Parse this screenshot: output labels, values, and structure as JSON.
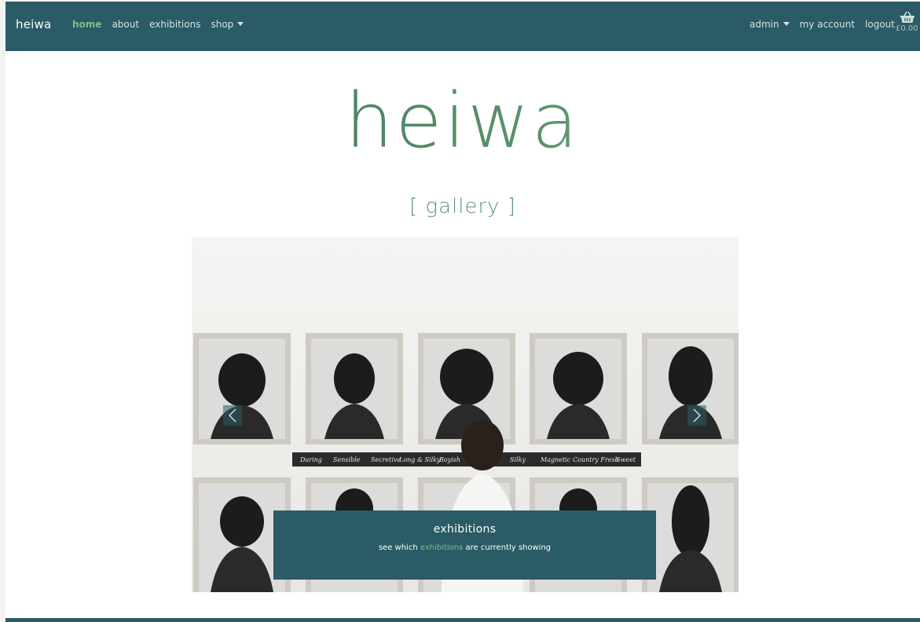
{
  "nav": {
    "brand": "heiwa",
    "items": [
      {
        "label": "home",
        "active": true
      },
      {
        "label": "about",
        "active": false
      },
      {
        "label": "exhibitions",
        "active": false
      },
      {
        "label": "shop",
        "active": false
      }
    ],
    "right_items": [
      {
        "label": "admin"
      },
      {
        "label": "my account"
      },
      {
        "label": "logout"
      }
    ],
    "basket_total": "£0.00",
    "basket_icon": "basket-icon"
  },
  "hero": {
    "logo": "heiwa",
    "tagline": "[ gallery ]"
  },
  "carousel": {
    "artwork_labels": [
      "Daring",
      "Sensible",
      "Secretive",
      "Long & Silky",
      "Boyish",
      "Silky",
      "Magnetic",
      "Country Fresh",
      "Sweet"
    ],
    "caption_title": "exhibitions",
    "caption_before": "see which ",
    "caption_link": "exhibitions",
    "caption_after": " are currently showing",
    "prev_icon": "chevron-left-icon",
    "next_icon": "chevron-right-icon"
  },
  "colors": {
    "navbar": "#2a5b66",
    "accent_green": "#7cc08d",
    "logo_green": "#58906a"
  }
}
